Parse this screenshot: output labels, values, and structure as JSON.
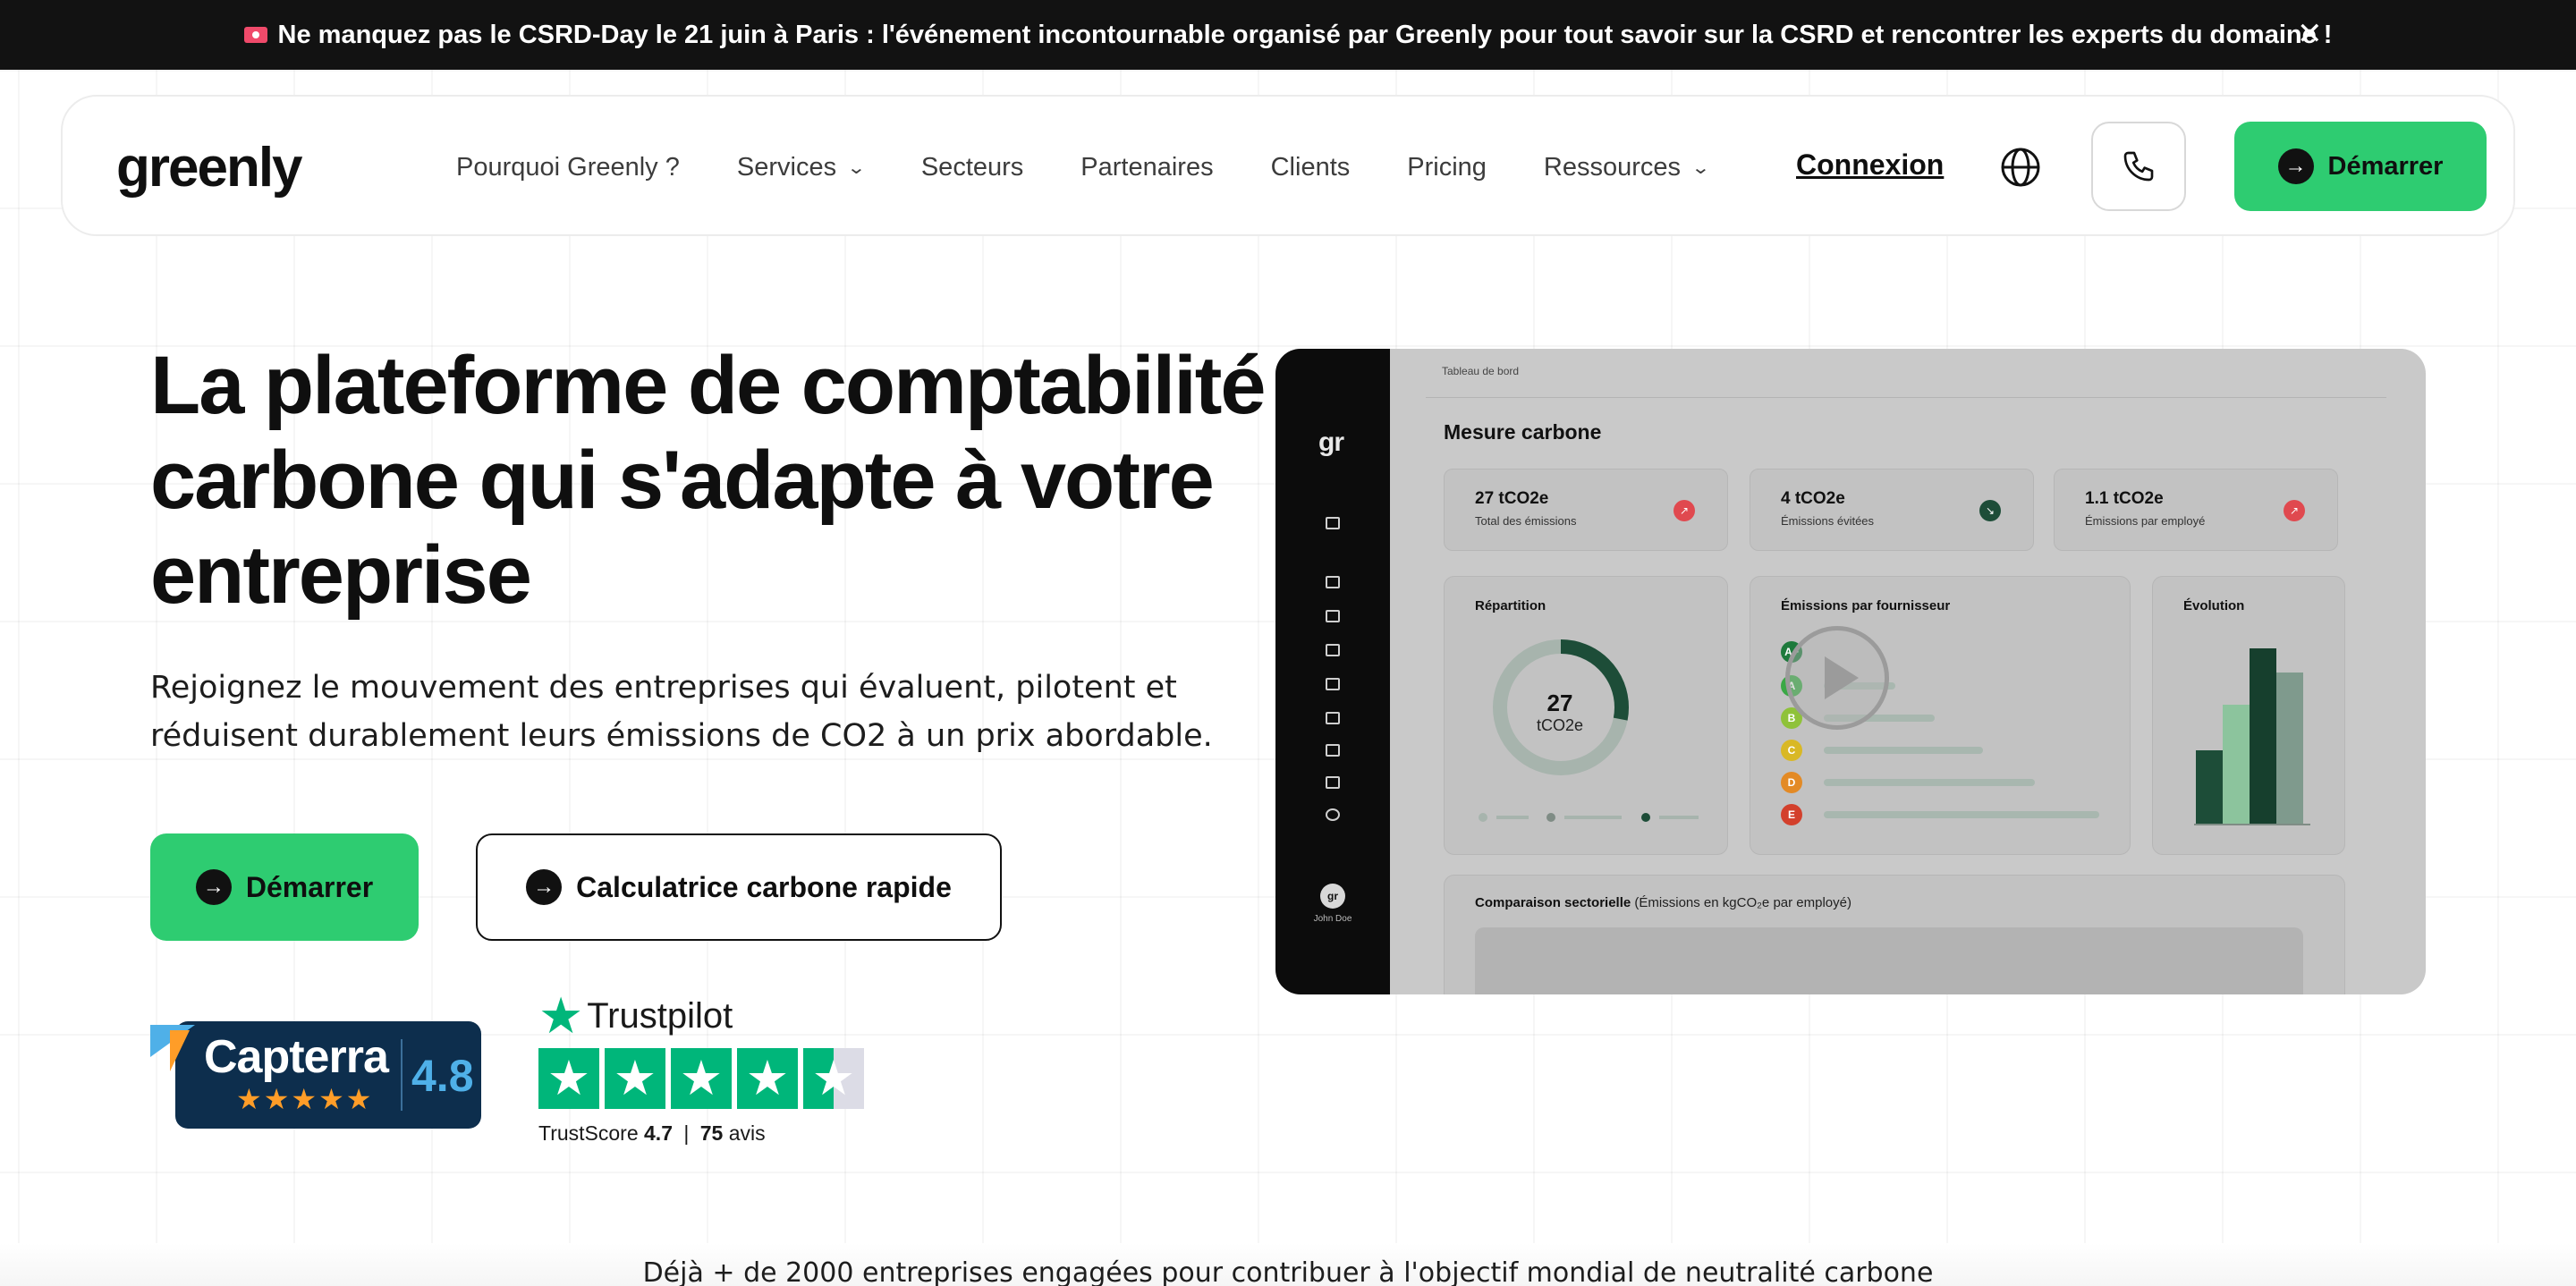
{
  "banner": {
    "text": "Ne manquez pas le CSRD-Day le 21 juin à Paris : l'événement incontournable organisé par Greenly pour tout savoir sur la CSRD et rencontrer les experts du domaine !",
    "close": "✕"
  },
  "nav": {
    "logo": "greenly",
    "links": [
      {
        "label": "Pourquoi Greenly ?"
      },
      {
        "label": "Services",
        "dropdown": true
      },
      {
        "label": "Secteurs"
      },
      {
        "label": "Partenaires"
      },
      {
        "label": "Clients"
      },
      {
        "label": "Pricing"
      },
      {
        "label": "Ressources",
        "dropdown": true
      }
    ],
    "login": "Connexion",
    "cta": "Démarrer",
    "icons": [
      "globe-icon",
      "phone-icon"
    ]
  },
  "hero": {
    "title": "La plateforme de comptabilité carbone qui s'adapte à votre entreprise",
    "subtitle": "Rejoignez le mouvement des entreprises qui évaluent, pilotent et réduisent durablement leurs émissions de CO2 à un prix abordable.",
    "primary_cta": "Démarrer",
    "secondary_cta": "Calculatrice carbone rapide"
  },
  "ratings": {
    "capterra": {
      "name": "Capterra",
      "score": "4.8",
      "stars": "★★★★★"
    },
    "trustpilot": {
      "name": "Trustpilot",
      "score_label": "TrustScore",
      "score": "4.7",
      "separator": "|",
      "count": "75",
      "count_label": "avis",
      "stars": 4.5
    }
  },
  "dashboard": {
    "breadcrumb": "Tableau de bord",
    "logo": "gr",
    "title": "Mesure carbone",
    "kpis": [
      {
        "value": "27 tCO2e",
        "label": "Total des émissions",
        "color": "#e0494f"
      },
      {
        "value": "4 tCO2e",
        "label": "Émissions évitées",
        "color": "#1d4d38"
      },
      {
        "value": "1.1 tCO2e",
        "label": "Émissions par employé",
        "color": "#e0494f"
      }
    ],
    "repartition": {
      "title": "Répartition",
      "value": "27",
      "unit": "tCO2e"
    },
    "fournisseurs": {
      "title": "Émissions par fournisseur",
      "grades": [
        {
          "g": "A+",
          "color": "#1e7a3c"
        },
        {
          "g": "A",
          "color": "#3aa845"
        },
        {
          "g": "B",
          "color": "#8fc23a"
        },
        {
          "g": "C",
          "color": "#d9b825"
        },
        {
          "g": "D",
          "color": "#e38a25"
        },
        {
          "g": "E",
          "color": "#d3402c"
        }
      ]
    },
    "evolution": {
      "title": "Évolution",
      "bars": [
        0.42,
        0.68,
        1.0,
        0.86
      ]
    },
    "comparaison": {
      "title": "Comparaison sectorielle",
      "subtitle": "(Émissions en kgCO₂e par employé)"
    },
    "user": {
      "initials": "gr",
      "name": "John Doe"
    }
  },
  "footer_teaser": "Déjà + de 2000 entreprises engagées pour contribuer à l'objectif mondial de neutralité carbone",
  "colors": {
    "brand_green": "#2ecc71",
    "dark": "#121212",
    "trustpilot_green": "#00b67a",
    "capterra_navy": "#0d2e4d"
  }
}
